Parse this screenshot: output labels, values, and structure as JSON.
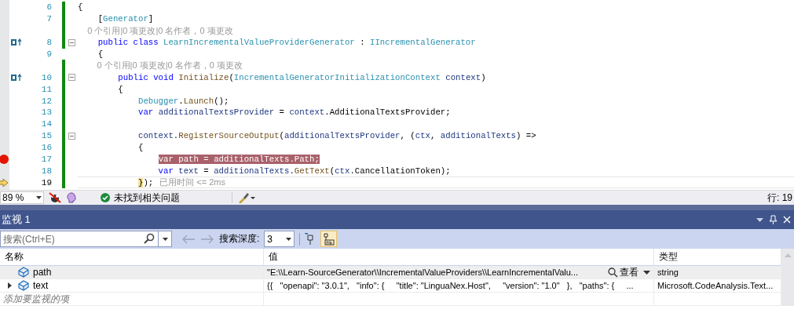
{
  "editor": {
    "lines": [
      {
        "kind": "code",
        "number": "6",
        "changed": true,
        "foldable": false,
        "breakpoint": false,
        "implements": false,
        "current": false,
        "segments": [
          {
            "kind": "plain",
            "text": "{"
          }
        ]
      },
      {
        "kind": "code",
        "number": "7",
        "changed": true,
        "foldable": false,
        "breakpoint": false,
        "implements": false,
        "current": false,
        "segments": [
          {
            "kind": "plain",
            "text": "    ["
          },
          {
            "kind": "type",
            "text": "Generator"
          },
          {
            "kind": "plain",
            "text": "]"
          }
        ]
      },
      {
        "kind": "lens",
        "changed": true,
        "text": "    0 个引用|0 项更改|0 名作者，0 项更改"
      },
      {
        "kind": "code",
        "number": "8",
        "changed": true,
        "foldable": true,
        "breakpoint": false,
        "implements": true,
        "current": false,
        "segments": [
          {
            "kind": "keyword",
            "text": "    public class "
          },
          {
            "kind": "type",
            "text": "LearnIncrementalValueProviderGenerator"
          },
          {
            "kind": "plain",
            "text": " : "
          },
          {
            "kind": "type",
            "text": "IIncrementalGenerator"
          }
        ]
      },
      {
        "kind": "code",
        "number": "9",
        "changed": false,
        "foldable": false,
        "breakpoint": false,
        "implements": false,
        "current": false,
        "segments": [
          {
            "kind": "plain",
            "text": "    {"
          }
        ]
      },
      {
        "kind": "lens",
        "changed": true,
        "text": "        0 个引用|0 项更改|0 名作者，0 项更改"
      },
      {
        "kind": "code",
        "number": "10",
        "changed": true,
        "foldable": true,
        "breakpoint": false,
        "implements": true,
        "current": false,
        "segments": [
          {
            "kind": "keyword",
            "text": "        public void "
          },
          {
            "kind": "method",
            "text": "Initialize"
          },
          {
            "kind": "plain",
            "text": "("
          },
          {
            "kind": "type",
            "text": "IncrementalGeneratorInitializationContext"
          },
          {
            "kind": "param",
            "text": " context"
          },
          {
            "kind": "plain",
            "text": ")"
          }
        ]
      },
      {
        "kind": "code",
        "number": "11",
        "changed": true,
        "foldable": false,
        "breakpoint": false,
        "implements": false,
        "current": false,
        "segments": [
          {
            "kind": "plain",
            "text": "        {"
          }
        ]
      },
      {
        "kind": "code",
        "number": "12",
        "changed": true,
        "foldable": false,
        "breakpoint": false,
        "implements": false,
        "current": false,
        "segments": [
          {
            "kind": "type",
            "text": "            Debugger"
          },
          {
            "kind": "plain",
            "text": "."
          },
          {
            "kind": "method",
            "text": "Launch"
          },
          {
            "kind": "plain",
            "text": "();"
          }
        ]
      },
      {
        "kind": "code",
        "number": "13",
        "changed": true,
        "foldable": false,
        "breakpoint": false,
        "implements": false,
        "current": false,
        "segments": [
          {
            "kind": "keyword",
            "text": "            var "
          },
          {
            "kind": "param",
            "text": "additionalTextsProvider"
          },
          {
            "kind": "plain",
            "text": " = "
          },
          {
            "kind": "param",
            "text": "context"
          },
          {
            "kind": "plain",
            "text": ".AdditionalTextsProvider;"
          }
        ]
      },
      {
        "kind": "code",
        "number": "14",
        "changed": true,
        "foldable": false,
        "breakpoint": false,
        "implements": false,
        "current": false
      },
      {
        "kind": "code",
        "number": "15",
        "changed": true,
        "foldable": true,
        "breakpoint": false,
        "implements": false,
        "current": false,
        "segments": [
          {
            "kind": "param",
            "text": "            context"
          },
          {
            "kind": "plain",
            "text": "."
          },
          {
            "kind": "method",
            "text": "RegisterSourceOutput"
          },
          {
            "kind": "plain",
            "text": "("
          },
          {
            "kind": "param",
            "text": "additionalTextsProvider"
          },
          {
            "kind": "plain",
            "text": ", ("
          },
          {
            "kind": "param",
            "text": "ctx"
          },
          {
            "kind": "plain",
            "text": ", "
          },
          {
            "kind": "param",
            "text": "additionalTexts"
          },
          {
            "kind": "plain",
            "text": ") =>"
          }
        ]
      },
      {
        "kind": "code",
        "number": "16",
        "changed": true,
        "foldable": false,
        "breakpoint": false,
        "implements": false,
        "current": false,
        "segments": [
          {
            "kind": "plain",
            "text": "            {"
          }
        ]
      },
      {
        "kind": "code",
        "number": "17",
        "changed": true,
        "foldable": false,
        "breakpoint": true,
        "implements": false,
        "current": false,
        "segments": [
          {
            "kind": "breakpoint",
            "text": "                var path = additionalTexts.Path;"
          }
        ]
      },
      {
        "kind": "code",
        "number": "18",
        "changed": true,
        "foldable": false,
        "breakpoint": false,
        "implements": false,
        "current": false,
        "segments": [
          {
            "kind": "keyword",
            "text": "                var "
          },
          {
            "kind": "param",
            "text": "text"
          },
          {
            "kind": "plain",
            "text": " = "
          },
          {
            "kind": "param",
            "text": "additionalTexts"
          },
          {
            "kind": "plain",
            "text": "."
          },
          {
            "kind": "method",
            "text": "GetText"
          },
          {
            "kind": "plain",
            "text": "("
          },
          {
            "kind": "param",
            "text": "ctx"
          },
          {
            "kind": "plain",
            "text": ".CancellationToken);"
          }
        ]
      },
      {
        "kind": "code",
        "number": "19",
        "changed": true,
        "foldable": false,
        "breakpoint": false,
        "implements": false,
        "current": true,
        "segments": [
          {
            "kind": "brace",
            "text": "            }"
          },
          {
            "kind": "plain",
            "text": ");"
          },
          {
            "kind": "hint",
            "text": "已用时间 <= 2ms"
          }
        ]
      }
    ]
  },
  "status_bar": {
    "zoom": "89 %",
    "issues": "未找到相关问题",
    "position": "行: 19"
  },
  "watch_panel": {
    "title": "监视 1",
    "search": {
      "placeholder": "搜索(Ctrl+E)"
    },
    "depth_label": "搜索深度:",
    "depth": "3",
    "string_format_toggle": {
      "selected": true
    },
    "columns": [
      "名称",
      "值",
      "类型"
    ],
    "rows": [
      {
        "name": "path",
        "value": "\"E:\\\\Learn-SourceGenerator\\\\IncrementalValueProviders\\\\LearnIncrementalValu...",
        "type": "string",
        "expandable": false,
        "selected": true,
        "visualizer": "查看"
      },
      {
        "name": "text",
        "value": "{{   \"openapi\": \"3.0.1\",   \"info\": {     \"title\": \"LinguaNex.Host\",     \"version\": \"1.0\"   },   \"paths\": {     ...",
        "type": "Microsoft.CodeAnalysis.Text...",
        "expandable": true,
        "selected": false
      }
    ],
    "add_placeholder": "添加要监视的项"
  }
}
